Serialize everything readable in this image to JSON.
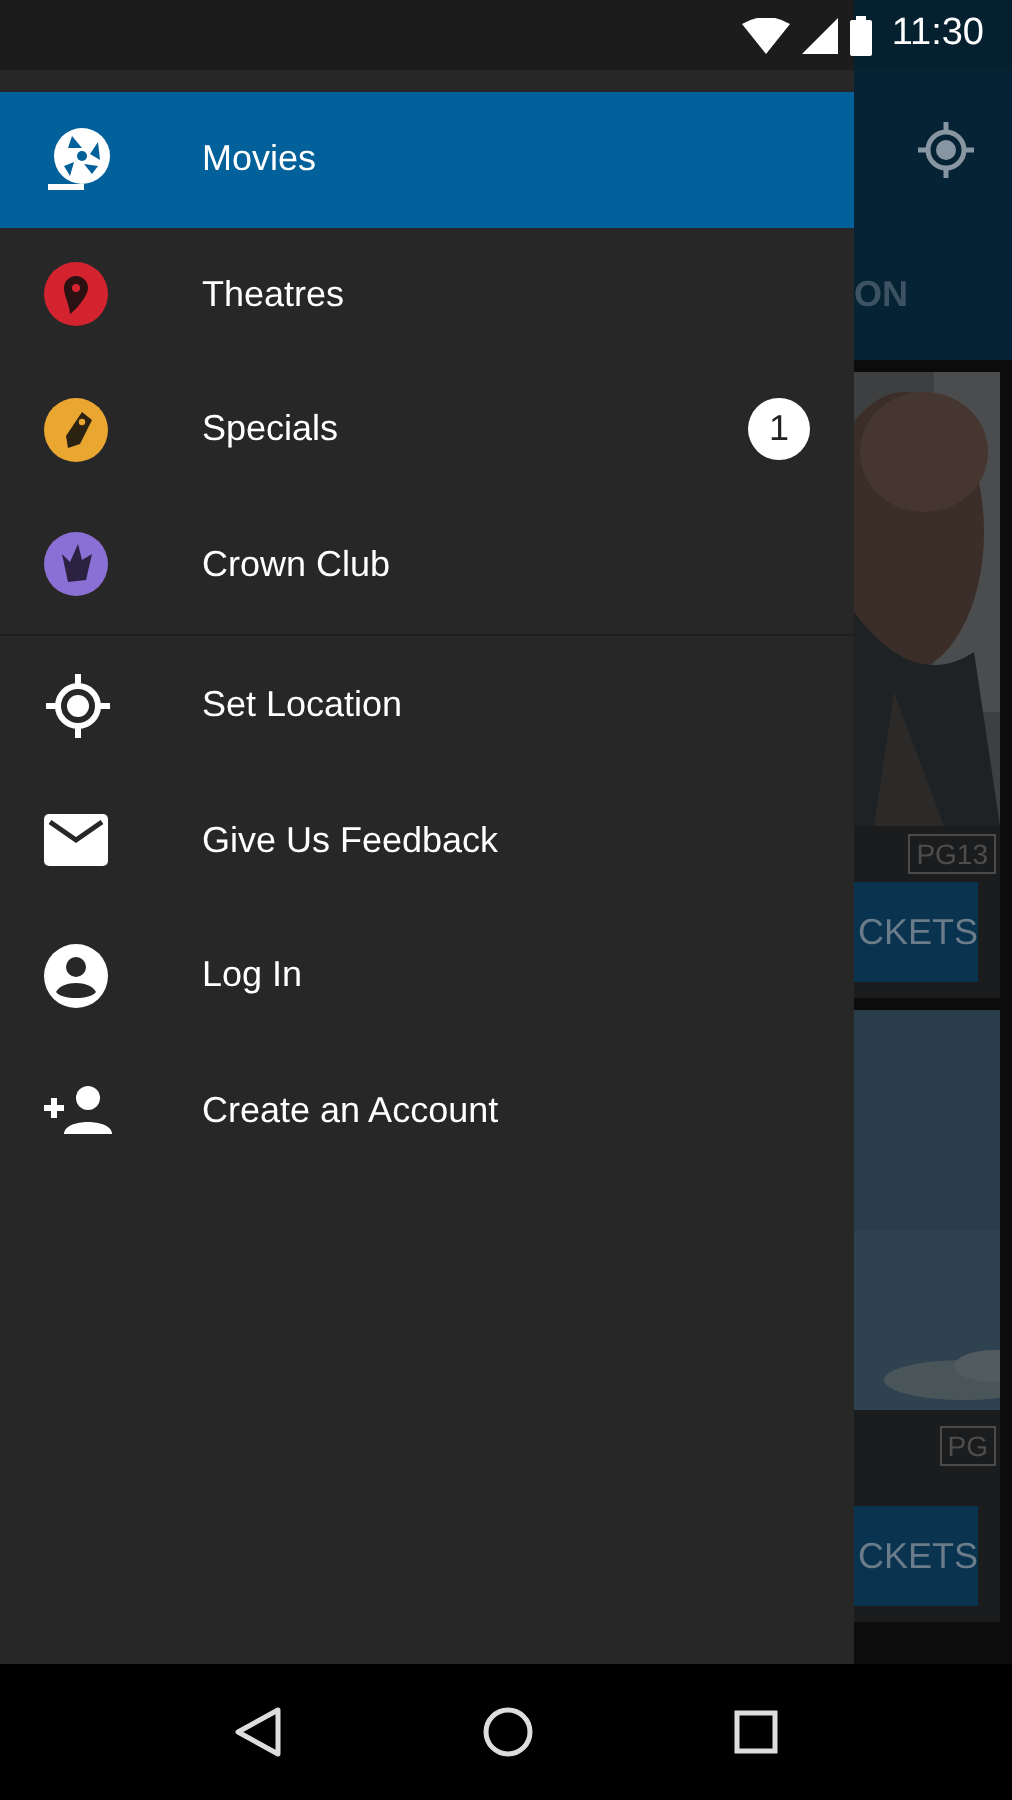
{
  "status_bar": {
    "time": "11:30"
  },
  "drawer": {
    "items": [
      {
        "kind": "reel",
        "label": "Movies",
        "selected": true
      },
      {
        "kind": "pin",
        "label": "Theatres",
        "selected": false,
        "color": "#d3232f"
      },
      {
        "kind": "tag",
        "label": "Specials",
        "selected": false,
        "color": "#e9a630",
        "badge": "1"
      },
      {
        "kind": "crown",
        "label": "Crown Club",
        "selected": false,
        "color": "#8a6fd4"
      },
      {
        "kind": "divider"
      },
      {
        "kind": "target",
        "label": "Set Location",
        "selected": false
      },
      {
        "kind": "mail",
        "label": "Give Us Feedback",
        "selected": false
      },
      {
        "kind": "account",
        "label": "Log In",
        "selected": false
      },
      {
        "kind": "add-person",
        "label": "Create an Account",
        "selected": false
      }
    ]
  },
  "background_app": {
    "tab_label": "ON",
    "cards": [
      {
        "kind": "picture",
        "rating": "PG13",
        "button": "CKETS"
      },
      {
        "kind": "picture",
        "rating": "PG",
        "button": "CKETS"
      }
    ]
  }
}
